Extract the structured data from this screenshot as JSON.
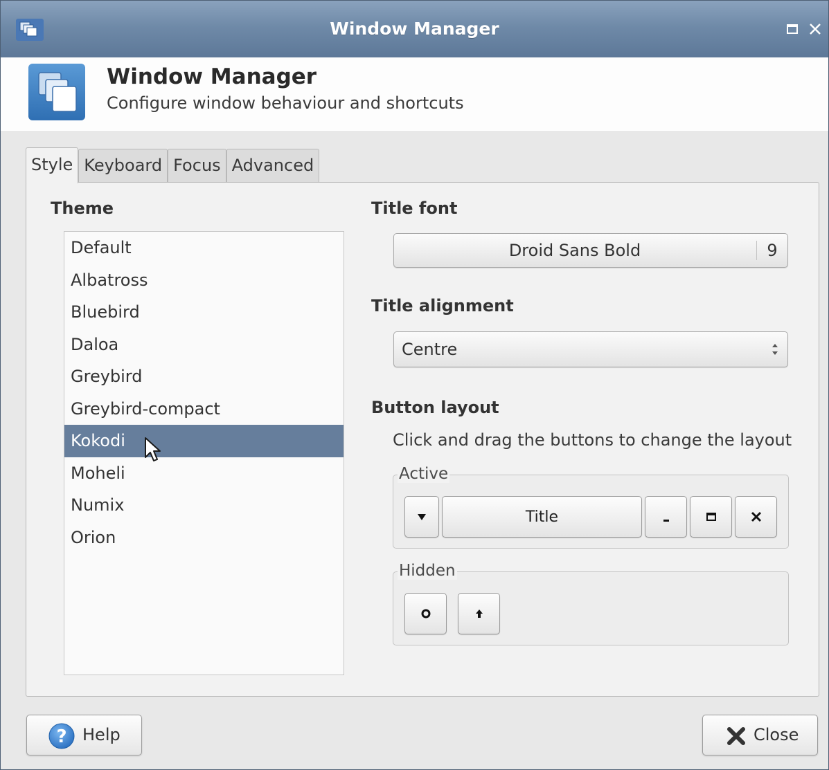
{
  "window": {
    "title": "Window Manager",
    "controls": {
      "maximize_icon": "maximize-icon",
      "close_icon": "close-icon"
    }
  },
  "header": {
    "title": "Window Manager",
    "subtitle": "Configure window behaviour and shortcuts",
    "icon": "window-manager-icon"
  },
  "tabs": [
    {
      "label": "Style",
      "active": true
    },
    {
      "label": "Keyboard",
      "active": false
    },
    {
      "label": "Focus",
      "active": false
    },
    {
      "label": "Advanced",
      "active": false
    }
  ],
  "style": {
    "theme_label": "Theme",
    "themes": [
      "Default",
      "Albatross",
      "Bluebird",
      "Daloa",
      "Greybird",
      "Greybird-compact",
      "Kokodi",
      "Moheli",
      "Numix",
      "Orion"
    ],
    "selected_theme": "Kokodi",
    "title_font_label": "Title font",
    "title_font_name": "Droid Sans Bold",
    "title_font_size": "9",
    "title_alignment_label": "Title alignment",
    "title_alignment_value": "Centre",
    "button_layout_label": "Button layout",
    "button_layout_hint": "Click and drag the buttons to change the layout",
    "active_label": "Active",
    "active_buttons": [
      {
        "kind": "menu",
        "icon": "menu-triangle-icon"
      },
      {
        "kind": "title",
        "label": "Title"
      },
      {
        "kind": "minimize",
        "icon": "minimize-icon"
      },
      {
        "kind": "maximize",
        "icon": "maximize-icon"
      },
      {
        "kind": "close",
        "icon": "close-icon"
      }
    ],
    "hidden_label": "Hidden",
    "hidden_buttons": [
      {
        "kind": "stick",
        "icon": "circle-icon"
      },
      {
        "kind": "shade",
        "icon": "up-arrow-icon"
      }
    ]
  },
  "footer": {
    "help_label": "Help",
    "close_label": "Close"
  },
  "colors": {
    "selection": "#667e9c",
    "titlebar": "#6f8aa8",
    "accent_blue": "#3f86c8"
  }
}
